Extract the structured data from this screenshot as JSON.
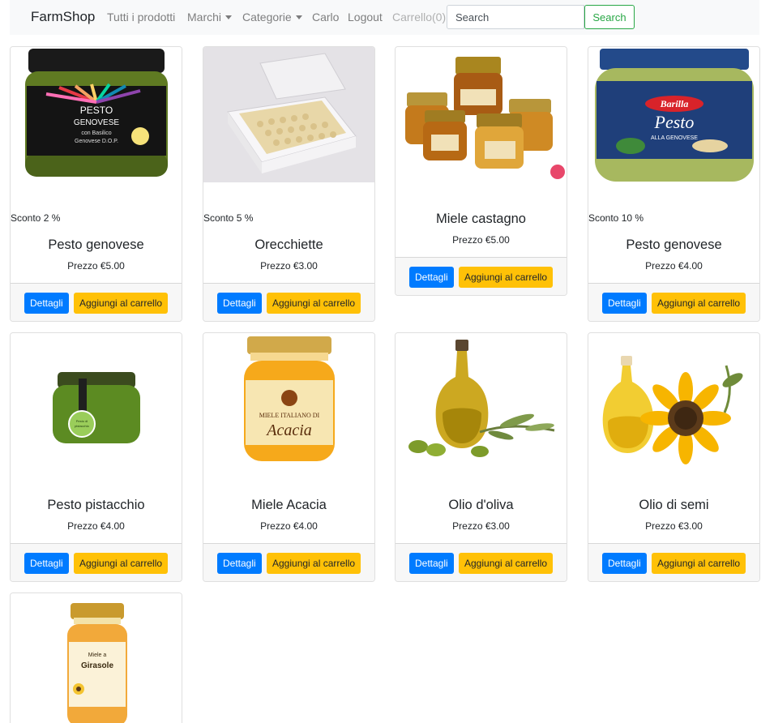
{
  "navbar": {
    "brand": "FarmShop",
    "links": {
      "all_products": "Tutti i prodotti",
      "brands": "Marchi",
      "categories": "Categorie",
      "user": "Carlo",
      "logout": "Logout",
      "cart": "Carrello(0)"
    },
    "search": {
      "placeholder": "Search",
      "button_label": "Search"
    }
  },
  "buttons": {
    "details": "Dettagli",
    "add_to_cart": "Aggiungi al carrello"
  },
  "colors": {
    "primary": "#007bff",
    "warning": "#ffc107",
    "success": "#28a745",
    "navbar_bg": "#f8f9fa"
  },
  "products": [
    {
      "name": "Pesto genovese",
      "price": "Prezzo €5.00",
      "discount": "Sconto 2 %",
      "image_icon": "pesto-jar-image"
    },
    {
      "name": "Orecchiette",
      "price": "Prezzo €3.00",
      "discount": "Sconto 5 %",
      "image_icon": "pasta-box-image"
    },
    {
      "name": "Miele castagno",
      "price": "Prezzo €5.00",
      "discount": "",
      "image_icon": "honey-jars-image"
    },
    {
      "name": "Pesto genovese",
      "price": "Prezzo €4.00",
      "discount": "Sconto 10 %",
      "image_icon": "barilla-pesto-jar-image"
    },
    {
      "name": "Pesto pistacchio",
      "price": "Prezzo €4.00",
      "discount": "",
      "image_icon": "pistachio-pesto-jar-image"
    },
    {
      "name": "Miele Acacia",
      "price": "Prezzo €4.00",
      "discount": "",
      "image_icon": "acacia-honey-jar-image"
    },
    {
      "name": "Olio d'oliva",
      "price": "Prezzo €3.00",
      "discount": "",
      "image_icon": "olive-oil-bottle-image"
    },
    {
      "name": "Olio di semi",
      "price": "Prezzo €3.00",
      "discount": "",
      "image_icon": "sunflower-oil-bottle-image"
    },
    {
      "name": "",
      "price": "",
      "discount": "",
      "image_icon": "sunflower-honey-jar-image"
    }
  ],
  "image_texts": {
    "p0": [
      "PESTO",
      "GENOVESE",
      "con Basilico",
      "Genovese D.O.P."
    ],
    "p3": [
      "Barilla",
      "Pesto",
      "ALLA GENOVESE"
    ],
    "p4": [
      "Pesto di pistacchio"
    ],
    "p5": [
      "MIELE ITALIANO DI",
      "Acacia"
    ],
    "p8": [
      "Miele a",
      "Girasole"
    ]
  }
}
